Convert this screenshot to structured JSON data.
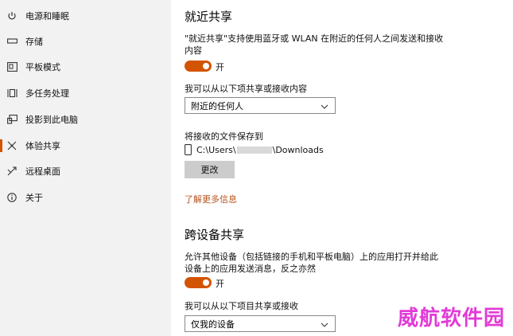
{
  "sidebar": {
    "items": [
      {
        "label": "电源和睡眠",
        "icon": "power-icon"
      },
      {
        "label": "存储",
        "icon": "storage-icon"
      },
      {
        "label": "平板模式",
        "icon": "tablet-mode-icon"
      },
      {
        "label": "多任务处理",
        "icon": "multitasking-icon"
      },
      {
        "label": "投影到此电脑",
        "icon": "project-icon"
      },
      {
        "label": "体验共享",
        "icon": "shared-experiences-icon"
      },
      {
        "label": "远程桌面",
        "icon": "remote-desktop-icon"
      },
      {
        "label": "关于",
        "icon": "info-icon"
      }
    ],
    "active_index": 5,
    "accent": "#d35400"
  },
  "nearby": {
    "title": "就近共享",
    "description_line1": "\"就近共享\"支持使用蓝牙或 WLAN 在附近的任何人之间发送和接收",
    "description_line2": "内容",
    "toggle_label": "开",
    "toggle_on": true,
    "share_label": "我可以从以下项共享或接收内容",
    "share_value": "附近的任何人",
    "save_label": "将接收的文件保存到",
    "path_prefix": "C:\\Users\\",
    "path_suffix": "\\Downloads",
    "change_button": "更改",
    "learn_more": "了解更多信息"
  },
  "cross_device": {
    "title": "跨设备共享",
    "description_line1": "允许其他设备（包括链接的手机和平板电脑）上的应用打开并给此",
    "description_line2": "设备上的应用发送消息，反之亦然",
    "toggle_label": "开",
    "toggle_on": true,
    "share_label": "我可以从以下项目共享或接收",
    "share_value": "仅我的设备"
  },
  "watermark": "威航软件园"
}
